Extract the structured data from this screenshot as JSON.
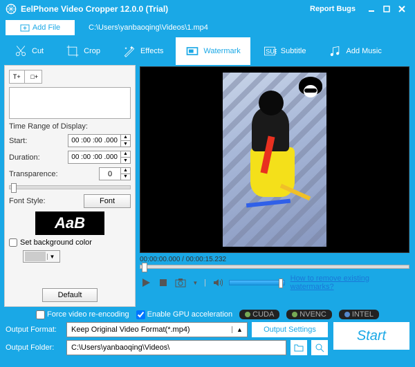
{
  "titlebar": {
    "title": "EelPhone Video Cropper 12.0.0 (Trial)",
    "report": "Report Bugs"
  },
  "filebar": {
    "add": "Add File",
    "path": "C:\\Users\\yanbaoqing\\Videos\\1.mp4"
  },
  "tabs": {
    "cut": "Cut",
    "crop": "Crop",
    "effects": "Effects",
    "watermark": "Watermark",
    "subtitle": "Subtitle",
    "music": "Add Music"
  },
  "sidebar": {
    "t_btn": "T+",
    "i_btn": "□+",
    "range_label": "Time Range of Display:",
    "start_label": "Start:",
    "start_val": "00 :00 :00 .000",
    "dur_label": "Duration:",
    "dur_val": "00 :00 :00 .000",
    "trans_label": "Transparence:",
    "trans_val": "0",
    "font_label": "Font Style:",
    "font_btn": "Font",
    "font_sample": "AaB",
    "bg_label": "Set background color",
    "default_btn": "Default"
  },
  "player": {
    "timecode": "00:00:00.000 / 00:00:15.232",
    "remove_link": "How to remove existing watermarks?"
  },
  "bottom": {
    "force": "Force video re-encoding",
    "gpu": "Enable GPU acceleration",
    "b1": "CUDA",
    "b2": "NVENC",
    "b3": "INTEL",
    "fmt_label": "Output Format:",
    "fmt_val": "Keep Original Video Format(*.mp4)",
    "settings": "Output Settings",
    "start": "Start",
    "fold_label": "Output Folder:",
    "fold_val": "C:\\Users\\yanbaoqing\\Videos\\"
  }
}
